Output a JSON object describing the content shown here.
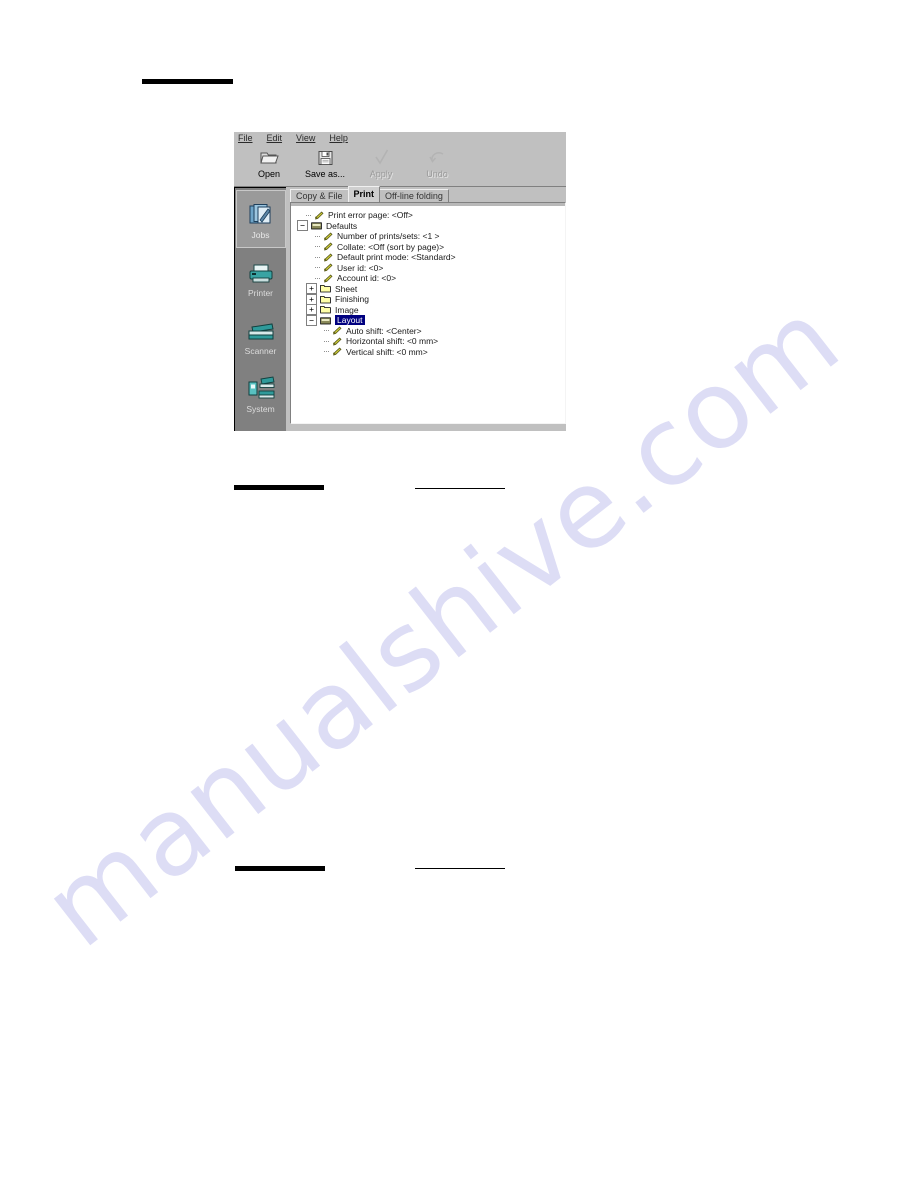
{
  "page": {
    "watermark_text": "manualshive.com",
    "watermark_color": "#c9c9ef"
  },
  "redactions": {
    "top_bar": "",
    "mid_bar": "",
    "mid_rule": "",
    "bottom_bar": "",
    "bottom_rule": ""
  },
  "app": {
    "menubar": [
      {
        "label": "File",
        "accel": "F"
      },
      {
        "label": "Edit",
        "accel": "E"
      },
      {
        "label": "View",
        "accel": "V"
      },
      {
        "label": "Help",
        "accel": "H"
      }
    ],
    "toolbar": [
      {
        "label": "Open",
        "icon": "open-folder-icon",
        "enabled": true
      },
      {
        "label": "Save as...",
        "icon": "floppy-disk-icon",
        "enabled": true
      },
      {
        "label": "Apply",
        "icon": "checkmark-icon",
        "enabled": false
      },
      {
        "label": "Undo",
        "icon": "undo-arrow-icon",
        "enabled": false
      }
    ],
    "sidebar": [
      {
        "label": "Jobs",
        "icon": "jobs-icon",
        "selected": true
      },
      {
        "label": "Printer",
        "icon": "printer-icon",
        "selected": false
      },
      {
        "label": "Scanner",
        "icon": "scanner-icon",
        "selected": false
      },
      {
        "label": "System",
        "icon": "system-icon",
        "selected": false
      }
    ],
    "tabs": [
      {
        "label": "Copy & File",
        "active": false
      },
      {
        "label": "Print",
        "active": true
      },
      {
        "label": "Off-line folding",
        "active": false
      }
    ],
    "tree": [
      {
        "label": "Print error page: <Off>",
        "depth": 1,
        "icon": "property-key-icon",
        "toggle": "none",
        "selected": false
      },
      {
        "label": "Defaults",
        "depth": 0,
        "icon": "open-folder-icon",
        "toggle": "minus",
        "selected": false
      },
      {
        "label": "Number of prints/sets: <1 >",
        "depth": 2,
        "icon": "property-key-icon",
        "toggle": "none",
        "selected": false
      },
      {
        "label": "Collate: <Off (sort by page)>",
        "depth": 2,
        "icon": "property-key-icon",
        "toggle": "none",
        "selected": false
      },
      {
        "label": "Default print mode: <Standard>",
        "depth": 2,
        "icon": "property-key-icon",
        "toggle": "none",
        "selected": false
      },
      {
        "label": "User id: <0>",
        "depth": 2,
        "icon": "property-key-icon",
        "toggle": "none",
        "selected": false
      },
      {
        "label": "Account id: <0>",
        "depth": 2,
        "icon": "property-key-icon",
        "toggle": "none",
        "selected": false
      },
      {
        "label": "Sheet",
        "depth": 1,
        "icon": "closed-folder-icon",
        "toggle": "plus",
        "selected": false
      },
      {
        "label": "Finishing",
        "depth": 1,
        "icon": "closed-folder-icon",
        "toggle": "plus",
        "selected": false
      },
      {
        "label": "Image",
        "depth": 1,
        "icon": "closed-folder-icon",
        "toggle": "plus",
        "selected": false
      },
      {
        "label": "Layout",
        "depth": 1,
        "icon": "open-folder-icon",
        "toggle": "minus",
        "selected": true
      },
      {
        "label": "Auto shift: <Center>",
        "depth": 3,
        "icon": "property-key-icon",
        "toggle": "none",
        "selected": false
      },
      {
        "label": "Horizontal shift: <0 mm>",
        "depth": 3,
        "icon": "property-key-icon",
        "toggle": "none",
        "selected": false
      },
      {
        "label": "Vertical shift: <0 mm>",
        "depth": 3,
        "icon": "property-key-icon",
        "toggle": "none",
        "selected": false
      }
    ]
  }
}
